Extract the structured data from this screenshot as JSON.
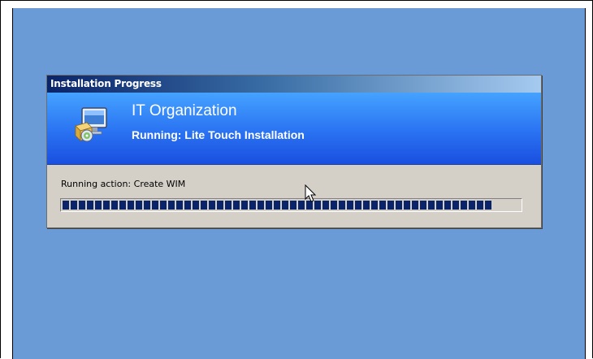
{
  "dialog": {
    "title": "Installation Progress",
    "organization": "IT Organization",
    "status": "Running: Lite Touch Installation",
    "action_text": "Running action: Create WIM",
    "progress_fraction": 0.94,
    "icon": "computer-install-icon"
  },
  "colors": {
    "desktop": "#6b9bd6",
    "banner_top": "#45a3ff",
    "banner_bottom": "#1a4fe0",
    "progress_block": "#0a246a",
    "dialog_face": "#d4d0c8"
  },
  "cursor": {
    "icon": "arrow-cursor-icon"
  }
}
